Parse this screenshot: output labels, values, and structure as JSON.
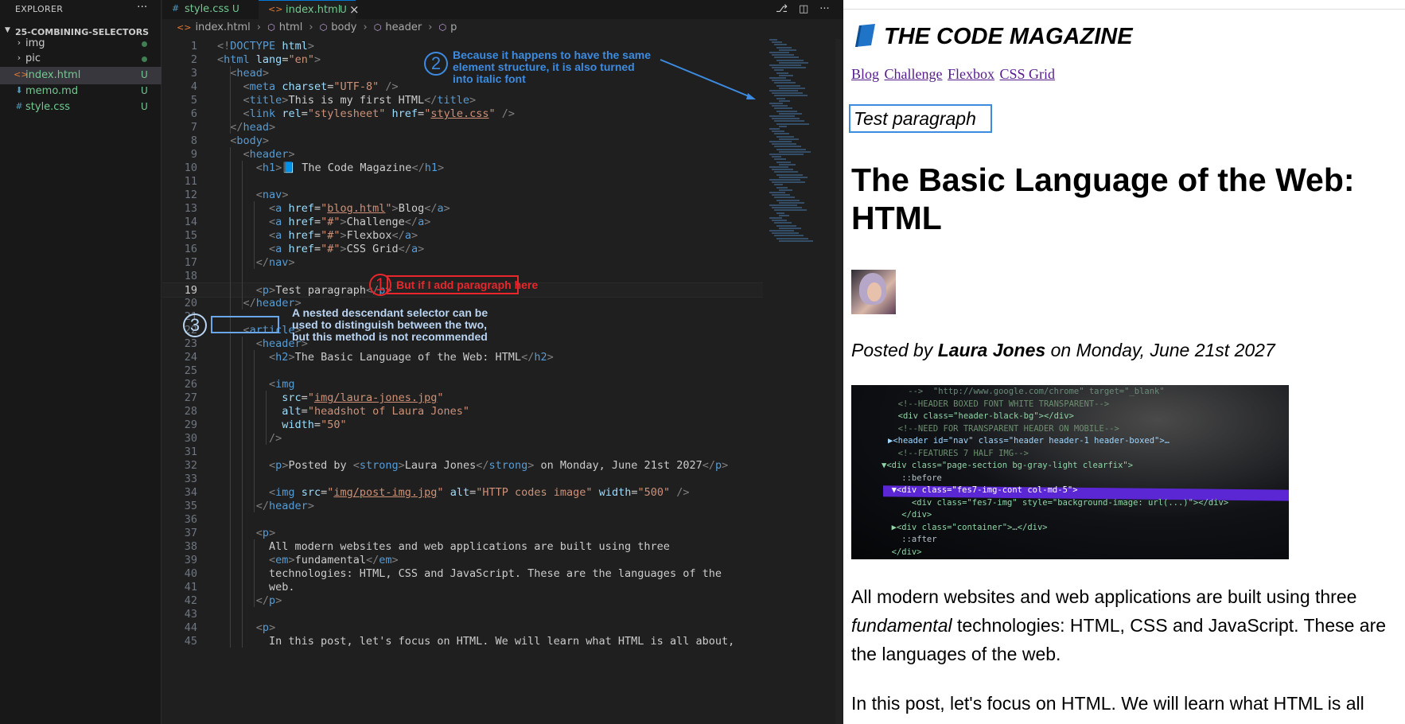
{
  "explorer": {
    "title": "EXPLORER",
    "menu": "···",
    "root_folder": "25-COMBINING-SELECTORS",
    "items": [
      {
        "icon": "›",
        "name": "img",
        "status": ""
      },
      {
        "icon": "›",
        "name": "pic",
        "status": ""
      },
      {
        "icon": "<>",
        "name": "index.html",
        "status": "U"
      },
      {
        "icon": "⬇",
        "name": "memo.md",
        "status": "U"
      },
      {
        "icon": "#",
        "name": "style.css",
        "status": "U"
      }
    ]
  },
  "tabs": [
    {
      "icon": "#",
      "name": "style.css",
      "status": "U"
    },
    {
      "icon": "<>",
      "name": "index.html",
      "status": "U",
      "close": "×"
    }
  ],
  "breadcrumb": [
    "index.html",
    "html",
    "body",
    "header",
    "p"
  ],
  "code_lines": [
    {
      "n": "1",
      "html": "<span class=p>&lt;!</span><span class=t>DOCTYPE</span> <span class=a>html</span><span class=p>&gt;</span>"
    },
    {
      "n": "2",
      "html": "<span class=p>&lt;</span><span class=t>html</span> <span class=a>lang</span>=<span class=s>\"en\"</span><span class=p>&gt;</span>"
    },
    {
      "n": "3",
      "html": "  <span class=p>&lt;</span><span class=t>head</span><span class=p>&gt;</span>"
    },
    {
      "n": "4",
      "html": "    <span class=p>&lt;</span><span class=t>meta</span> <span class=a>charset</span>=<span class=s>\"UTF-8\"</span> <span class=p>/&gt;</span>"
    },
    {
      "n": "5",
      "html": "    <span class=p>&lt;</span><span class=t>title</span><span class=p>&gt;</span>This is my first HTML<span class=p>&lt;/</span><span class=t>title</span><span class=p>&gt;</span>"
    },
    {
      "n": "6",
      "html": "    <span class=p>&lt;</span><span class=t>link</span> <span class=a>rel</span>=<span class=s>\"stylesheet\"</span> <span class=a>href</span>=<span class=s>\"</span><span class=su>style.css</span><span class=s>\"</span> <span class=p>/&gt;</span>"
    },
    {
      "n": "7",
      "html": "  <span class=p>&lt;/</span><span class=t>head</span><span class=p>&gt;</span>"
    },
    {
      "n": "8",
      "html": "  <span class=p>&lt;</span><span class=t>body</span><span class=p>&gt;</span>"
    },
    {
      "n": "9",
      "html": "    <span class=p>&lt;</span><span class=t>header</span><span class=p>&gt;</span>"
    },
    {
      "n": "10",
      "html": "      <span class=p>&lt;</span><span class=t>h1</span><span class=p>&gt;</span>📘 The Code Magazine<span class=p>&lt;/</span><span class=t>h1</span><span class=p>&gt;</span>"
    },
    {
      "n": "11",
      "html": ""
    },
    {
      "n": "12",
      "html": "      <span class=p>&lt;</span><span class=t>nav</span><span class=p>&gt;</span>"
    },
    {
      "n": "13",
      "html": "        <span class=p>&lt;</span><span class=t>a</span> <span class=a>href</span>=<span class=s>\"</span><span class=su>blog.html</span><span class=s>\"</span><span class=p>&gt;</span>Blog<span class=p>&lt;/</span><span class=t>a</span><span class=p>&gt;</span>"
    },
    {
      "n": "14",
      "html": "        <span class=p>&lt;</span><span class=t>a</span> <span class=a>href</span>=<span class=s>\"#\"</span><span class=p>&gt;</span>Challenge<span class=p>&lt;/</span><span class=t>a</span><span class=p>&gt;</span>"
    },
    {
      "n": "15",
      "html": "        <span class=p>&lt;</span><span class=t>a</span> <span class=a>href</span>=<span class=s>\"#\"</span><span class=p>&gt;</span>Flexbox<span class=p>&lt;/</span><span class=t>a</span><span class=p>&gt;</span>"
    },
    {
      "n": "16",
      "html": "        <span class=p>&lt;</span><span class=t>a</span> <span class=a>href</span>=<span class=s>\"#\"</span><span class=p>&gt;</span>CSS Grid<span class=p>&lt;/</span><span class=t>a</span><span class=p>&gt;</span>"
    },
    {
      "n": "17",
      "html": "      <span class=p>&lt;/</span><span class=t>nav</span><span class=p>&gt;</span>"
    },
    {
      "n": "18",
      "html": ""
    },
    {
      "n": "19",
      "html": "      <span class=p>&lt;</span><span class=t>p</span><span class=p>&gt;</span>Test paragraph<span class=p>&lt;/</span><span class=t>p</span><span class=p>&gt;</span>"
    },
    {
      "n": "20",
      "html": "    <span class=p>&lt;/</span><span class=t>header</span><span class=p>&gt;</span>"
    },
    {
      "n": "21",
      "html": ""
    },
    {
      "n": "22",
      "html": "    <span class=p>&lt;</span><span class=t>article</span><span class=p>&gt;</span>"
    },
    {
      "n": "23",
      "html": "      <span class=p>&lt;</span><span class=t>header</span><span class=p>&gt;</span>"
    },
    {
      "n": "24",
      "html": "        <span class=p>&lt;</span><span class=t>h2</span><span class=p>&gt;</span>The Basic Language of the Web: HTML<span class=p>&lt;/</span><span class=t>h2</span><span class=p>&gt;</span>"
    },
    {
      "n": "25",
      "html": ""
    },
    {
      "n": "26",
      "html": "        <span class=p>&lt;</span><span class=t>img</span>"
    },
    {
      "n": "27",
      "html": "          <span class=a>src</span>=<span class=s>\"</span><span class=su>img/laura-jones.jpg</span><span class=s>\"</span>"
    },
    {
      "n": "28",
      "html": "          <span class=a>alt</span>=<span class=s>\"headshot of Laura Jones\"</span>"
    },
    {
      "n": "29",
      "html": "          <span class=a>width</span>=<span class=s>\"50\"</span>"
    },
    {
      "n": "30",
      "html": "        <span class=p>/&gt;</span>"
    },
    {
      "n": "31",
      "html": ""
    },
    {
      "n": "32",
      "html": "        <span class=p>&lt;</span><span class=t>p</span><span class=p>&gt;</span>Posted by <span class=p>&lt;</span><span class=t>strong</span><span class=p>&gt;</span>Laura Jones<span class=p>&lt;/</span><span class=t>strong</span><span class=p>&gt;</span> on Monday, June 21st 2027<span class=p>&lt;/</span><span class=t>p</span><span class=p>&gt;</span>"
    },
    {
      "n": "33",
      "html": ""
    },
    {
      "n": "34",
      "html": "        <span class=p>&lt;</span><span class=t>img</span> <span class=a>src</span>=<span class=s>\"</span><span class=su>img/post-img.jpg</span><span class=s>\"</span> <span class=a>alt</span>=<span class=s>\"HTTP codes image\"</span> <span class=a>width</span>=<span class=s>\"500\"</span> <span class=p>/&gt;</span>"
    },
    {
      "n": "35",
      "html": "      <span class=p>&lt;/</span><span class=t>header</span><span class=p>&gt;</span>"
    },
    {
      "n": "36",
      "html": ""
    },
    {
      "n": "37",
      "html": "      <span class=p>&lt;</span><span class=t>p</span><span class=p>&gt;</span>"
    },
    {
      "n": "38",
      "html": "        All modern websites and web applications are built using three"
    },
    {
      "n": "39",
      "html": "        <span class=p>&lt;</span><span class=t>em</span><span class=p>&gt;</span>fundamental<span class=p>&lt;/</span><span class=t>em</span><span class=p>&gt;</span>"
    },
    {
      "n": "40",
      "html": "        technologies: HTML, CSS and JavaScript. These are the languages of the"
    },
    {
      "n": "41",
      "html": "        web."
    },
    {
      "n": "42",
      "html": "      <span class=p>&lt;/</span><span class=t>p</span><span class=p>&gt;</span>"
    },
    {
      "n": "43",
      "html": ""
    },
    {
      "n": "44",
      "html": "      <span class=p>&lt;</span><span class=t>p</span><span class=p>&gt;</span>"
    },
    {
      "n": "45",
      "html": "        In this post, let's focus on HTML. We will learn what HTML is all about,"
    }
  ],
  "annotations": {
    "a1_num": "1",
    "a1_text": "But if I add paragraph here",
    "a2_num": "2",
    "a2_text": "Because it happens to have the same\nelement structure, it is also turned\ninto italic font",
    "a3_num": "3",
    "a3_text": "A nested descendant selector can be\nused to distinguish between the two,\nbut this method is not recommended",
    "red": "#e8262b",
    "blue": "#3d8be0"
  },
  "preview": {
    "site_title": "THE CODE MAGAZINE",
    "nav": [
      "Blog",
      "Challenge",
      "Flexbox",
      "CSS Grid"
    ],
    "test_paragraph": "Test paragraph",
    "post_title": "The Basic Language of the Web: HTML",
    "posted_prefix": "Posted by ",
    "author": "Laura Jones",
    "posted_suffix": " on Monday, June 21st 2027",
    "p1_before": "All modern websites and web applications are built using three ",
    "p1_em": "fundamental",
    "p1_after": " technologies: HTML, CSS and JavaScript. These are the languages of the web.",
    "p2": "In this post, let's focus on HTML. We will learn what HTML is all",
    "image_lines": [
      "    -->  \"http://www.google.com/chrome\" target=\"_blank\"",
      "  <!--HEADER BOXED FONT WHITE TRANSPARENT-->",
      "  <div class=\"header-black-bg\"></div>",
      "  <!--NEED FOR TRANSPARENT HEADER ON MOBILE-->",
      "▶<header id=\"nav\" class=\"header header-1 header-boxed\">…",
      "  <!--FEATURES 7 HALF IMG-->",
      "▼<div class=\"page-section bg-gray-light clearfix\">",
      "    ::before",
      "  ▼<div class=\"fes7-img-cont col-md-5\">",
      "      <div class=\"fes7-img\" style=\"background-image: url(...)\"></div>",
      "    </div>",
      "  ▶<div class=\"container\">…</div>",
      "    ::after",
      "  </div>"
    ]
  }
}
